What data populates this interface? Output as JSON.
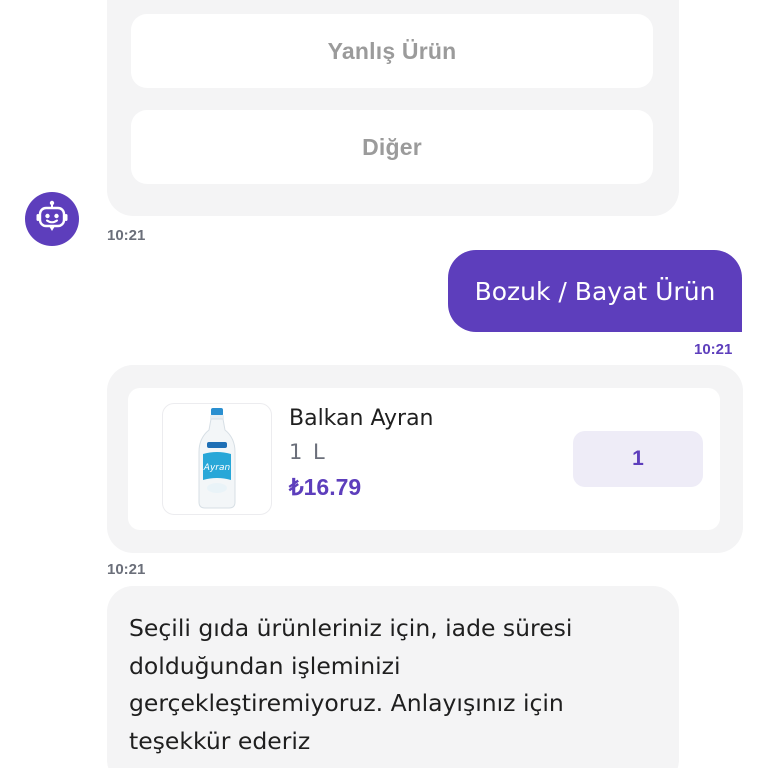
{
  "options": {
    "items": [
      "Yanlış Ürün",
      "Diğer"
    ]
  },
  "bot": {
    "avatar_icon": "robot-icon",
    "color": "#5d3ebc"
  },
  "times": {
    "bot_options_time": "10:21",
    "user_reply_time": "10:21",
    "product_time": "10:21"
  },
  "user_message": {
    "text": "Bozuk / Bayat Ürün"
  },
  "product": {
    "name": "Balkan Ayran",
    "size": "1 L",
    "price": "₺16.79",
    "quantity": "1",
    "image_icon": "ayran-bottle-icon"
  },
  "bot_message": {
    "text": "Seçili gıda ürünleriniz için, iade süresi dolduğundan işleminizi gerçekleştiremiyoruz. Anlayışınız için teşekkür ederiz"
  },
  "colors": {
    "accent": "#5d3ebc",
    "bubble_bg": "#f4f4f5",
    "muted_text": "#6b6f7a"
  }
}
